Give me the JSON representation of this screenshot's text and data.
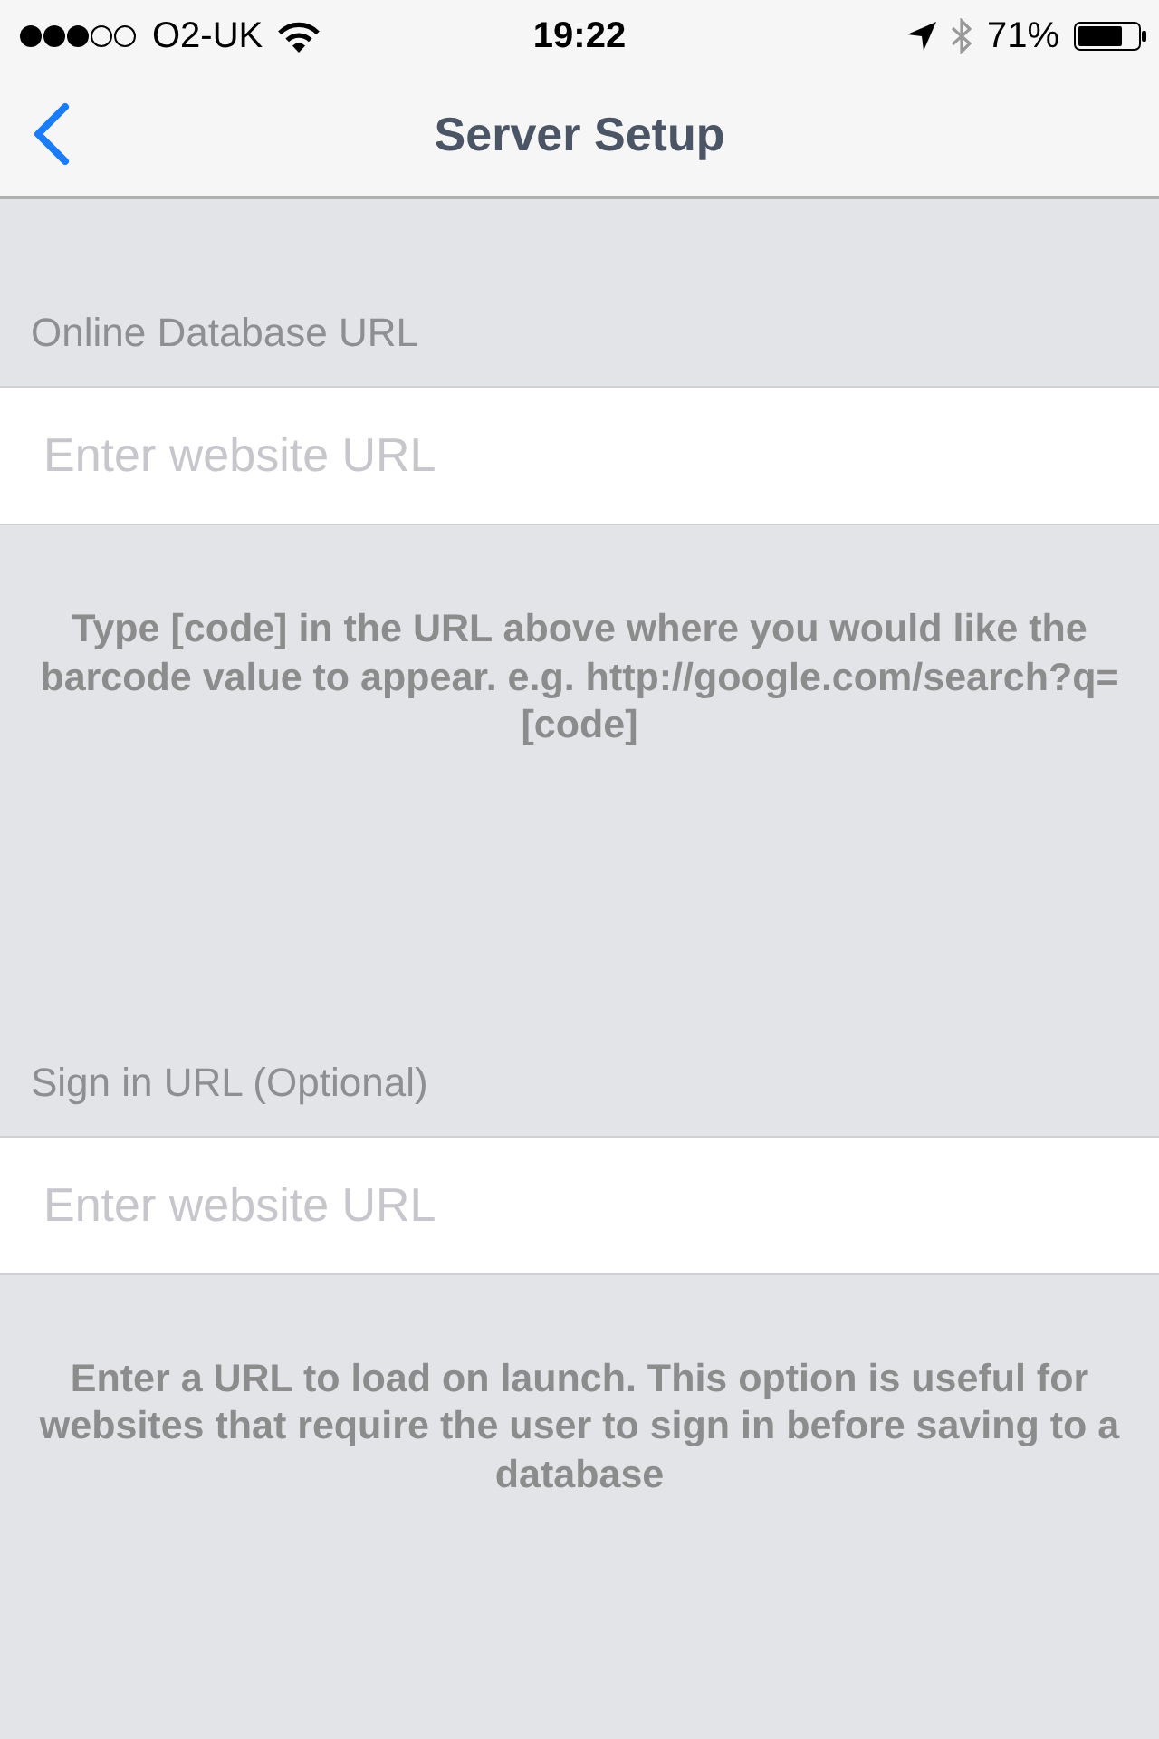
{
  "status_bar": {
    "carrier": "O2-UK",
    "time": "19:22",
    "battery_percent": "71%"
  },
  "nav_bar": {
    "title": "Server Setup"
  },
  "sections": [
    {
      "header": "Online Database URL",
      "field": {
        "placeholder": "Enter website URL"
      },
      "footer": "Type [code] in the URL above where you would like the barcode value to appear. e.g. http://google.com/search?q=[code]"
    },
    {
      "header": "Sign in URL (Optional)",
      "field": {
        "placeholder": "Enter website URL"
      },
      "footer": "Enter a URL to load on launch. This option is useful for websites that require the user to sign in before saving to a database"
    }
  ]
}
